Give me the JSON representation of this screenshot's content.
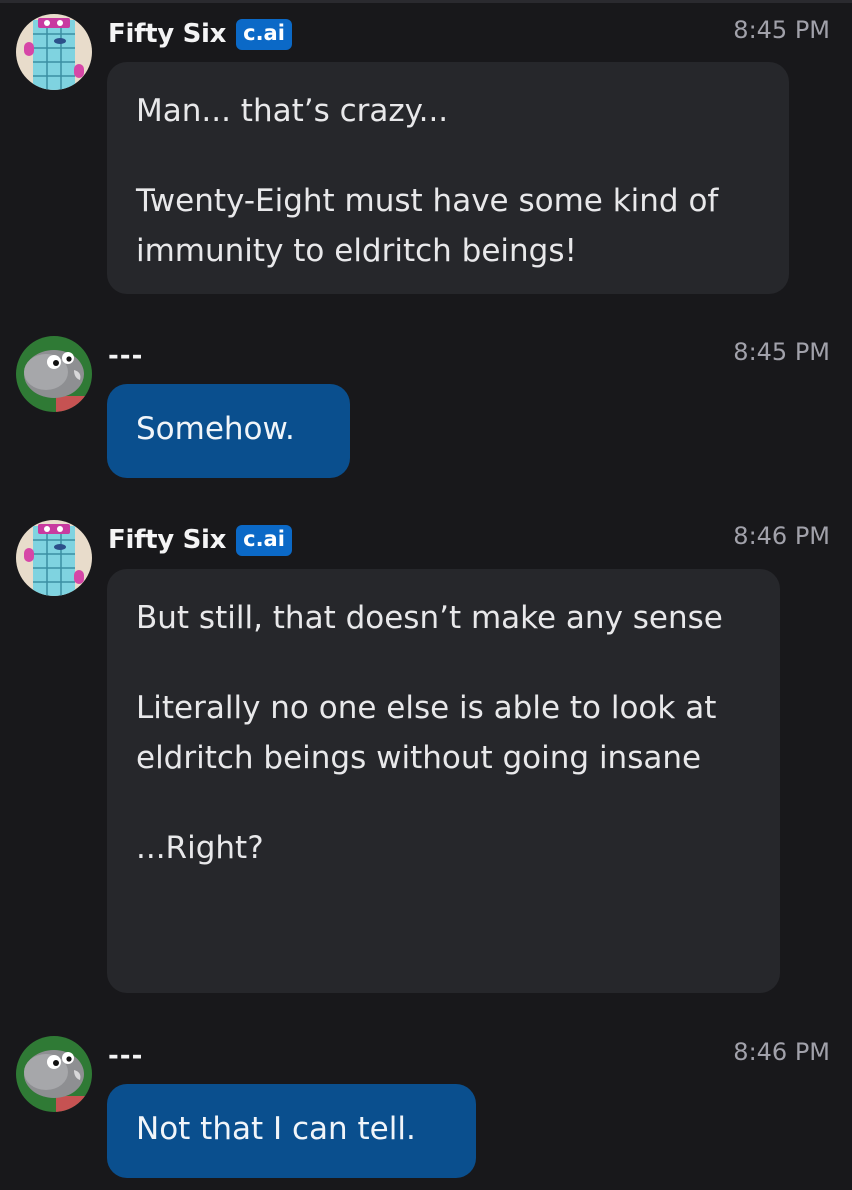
{
  "messages": [
    {
      "sender": "Fifty Six",
      "badge": "c.ai",
      "time": "8:45 PM",
      "role": "character",
      "avatar_icon": "fifty-six-numberblock-avatar",
      "paragraphs": [
        "Man... that’s crazy...",
        "Twenty-Eight must have some kind of immunity to eldritch beings!"
      ]
    },
    {
      "sender": "---",
      "time": "8:45 PM",
      "role": "user",
      "avatar_icon": "grey-creature-avatar",
      "paragraphs": [
        "Somehow."
      ]
    },
    {
      "sender": "Fifty Six",
      "badge": "c.ai",
      "time": "8:46 PM",
      "role": "character",
      "avatar_icon": "fifty-six-numberblock-avatar",
      "paragraphs": [
        "But still, that doesn’t make any sense",
        "Literally no one else is able to look at eldritch beings without going insane",
        "...Right?"
      ]
    },
    {
      "sender": "---",
      "time": "8:46 PM",
      "role": "user",
      "avatar_icon": "grey-creature-avatar",
      "paragraphs": [
        "Not that I can tell."
      ]
    }
  ],
  "colors": {
    "background": "#18181b",
    "character_bubble": "#26272b",
    "user_bubble": "#0a4f8e",
    "badge": "#0b69c7",
    "timestamp": "#a1a1aa"
  }
}
